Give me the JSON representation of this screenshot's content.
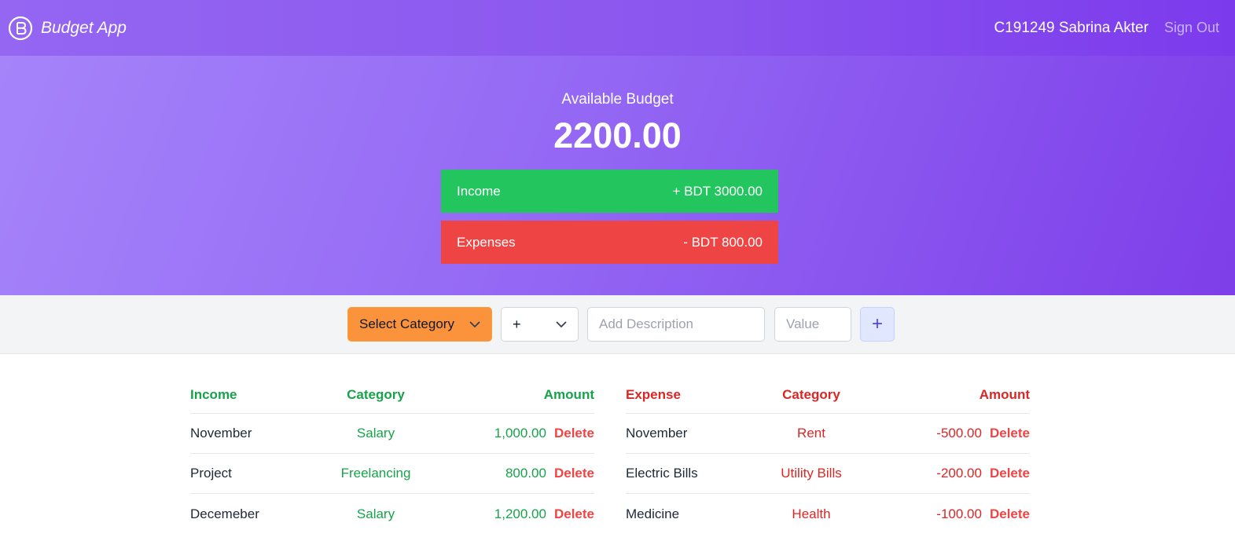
{
  "navbar": {
    "brand": "Budget App",
    "user": "C191249 Sabrina Akter",
    "signout": "Sign Out"
  },
  "hero": {
    "label": "Available Budget",
    "amount": "2200.00",
    "income_label": "Income",
    "income_value": "+ BDT 3000.00",
    "expense_label": "Expenses",
    "expense_value": "- BDT 800.00",
    "colors": {
      "income": "#22c55e",
      "expense": "#ef4444"
    }
  },
  "form": {
    "category": "Select Category",
    "type": "+",
    "description_placeholder": "Add Description",
    "value_placeholder": "Value",
    "add": "+"
  },
  "income_table": {
    "headers": [
      "Income",
      "Category",
      "Amount"
    ],
    "rows": [
      {
        "name": "November",
        "category": "Salary",
        "amount": "1,000.00",
        "action": "Delete"
      },
      {
        "name": "Project",
        "category": "Freelancing",
        "amount": "800.00",
        "action": "Delete"
      },
      {
        "name": "Decemeber",
        "category": "Salary",
        "amount": "1,200.00",
        "action": "Delete"
      }
    ]
  },
  "expense_table": {
    "headers": [
      "Expense",
      "Category",
      "Amount"
    ],
    "rows": [
      {
        "name": "November",
        "category": "Rent",
        "amount": "-500.00",
        "action": "Delete"
      },
      {
        "name": "Electric Bills",
        "category": "Utility Bills",
        "amount": "-200.00",
        "action": "Delete"
      },
      {
        "name": "Medicine",
        "category": "Health",
        "amount": "-100.00",
        "action": "Delete"
      }
    ]
  }
}
